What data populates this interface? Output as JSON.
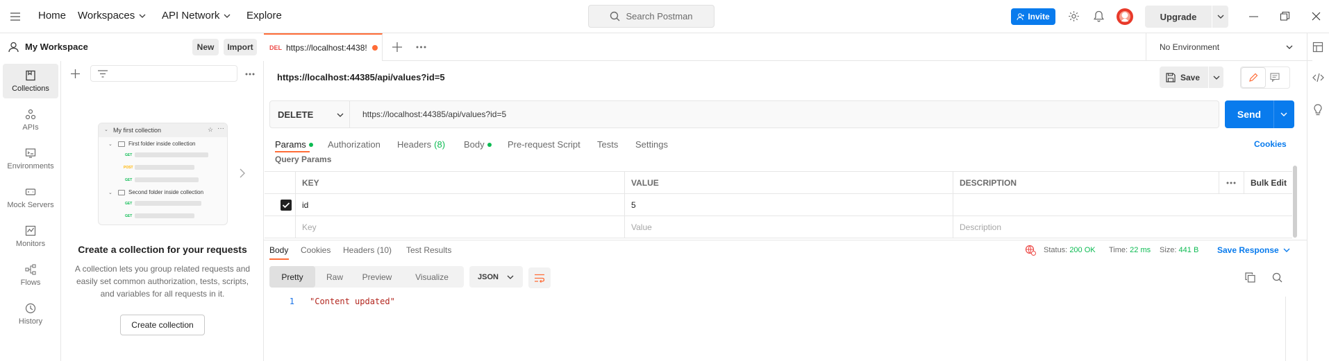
{
  "topbar": {
    "home": "Home",
    "workspaces": "Workspaces",
    "api_network": "API Network",
    "explore": "Explore",
    "search_placeholder": "Search Postman",
    "invite": "Invite",
    "upgrade": "Upgrade"
  },
  "workspace": {
    "name": "My Workspace",
    "new_button": "New",
    "import_button": "Import"
  },
  "rail": {
    "items": [
      {
        "label": "Collections",
        "icon": "collections-icon"
      },
      {
        "label": "APIs",
        "icon": "apis-icon"
      },
      {
        "label": "Environments",
        "icon": "environments-icon"
      },
      {
        "label": "Mock Servers",
        "icon": "mock-servers-icon"
      },
      {
        "label": "Monitors",
        "icon": "monitors-icon"
      },
      {
        "label": "Flows",
        "icon": "flows-icon"
      },
      {
        "label": "History",
        "icon": "history-icon"
      }
    ]
  },
  "sidebar": {
    "illustration": {
      "collection_name": "My first collection",
      "folder1": "First folder inside collection",
      "folder2": "Second folder inside collection",
      "get": "GET",
      "post": "POST"
    },
    "empty_title": "Create a collection for your requests",
    "empty_desc": "A collection lets you group related requests and easily set common authorization, tests, scripts, and variables for all requests in it.",
    "create_button": "Create collection"
  },
  "tab": {
    "method": "DEL",
    "title": "https://localhost:4438!"
  },
  "environment": "No Environment",
  "request": {
    "title": "https://localhost:44385/api/values?id=5",
    "save": "Save",
    "method": "DELETE",
    "url": "https://localhost:44385/api/values?id=5",
    "send": "Send"
  },
  "request_tabs": {
    "params": "Params",
    "authorization": "Authorization",
    "headers": "Headers",
    "headers_count": "(8)",
    "body": "Body",
    "prerequest": "Pre-request Script",
    "tests": "Tests",
    "settings": "Settings",
    "cookies": "Cookies"
  },
  "params": {
    "section_label": "Query Params",
    "headers": {
      "key": "KEY",
      "value": "VALUE",
      "description": "DESCRIPTION",
      "bulk_edit": "Bulk Edit"
    },
    "rows": [
      {
        "key": "id",
        "value": "5",
        "description": ""
      }
    ],
    "placeholders": {
      "key": "Key",
      "value": "Value",
      "description": "Description"
    }
  },
  "response": {
    "tabs": {
      "body": "Body",
      "cookies": "Cookies",
      "headers": "Headers (10)",
      "tests": "Test Results"
    },
    "status_label": "Status:",
    "status_value": "200 OK",
    "time_label": "Time:",
    "time_value": "22 ms",
    "size_label": "Size:",
    "size_value": "441 B",
    "save_response": "Save Response",
    "views": {
      "pretty": "Pretty",
      "raw": "Raw",
      "preview": "Preview",
      "visualize": "Visualize"
    },
    "format": "JSON",
    "lines": [
      {
        "n": "1",
        "text": "\"Content updated\""
      }
    ]
  },
  "colors": {
    "accent_orange": "#ff6c37",
    "primary_blue": "#097bed",
    "status_green": "#0cbb52",
    "delete_red": "#ed4b48"
  }
}
